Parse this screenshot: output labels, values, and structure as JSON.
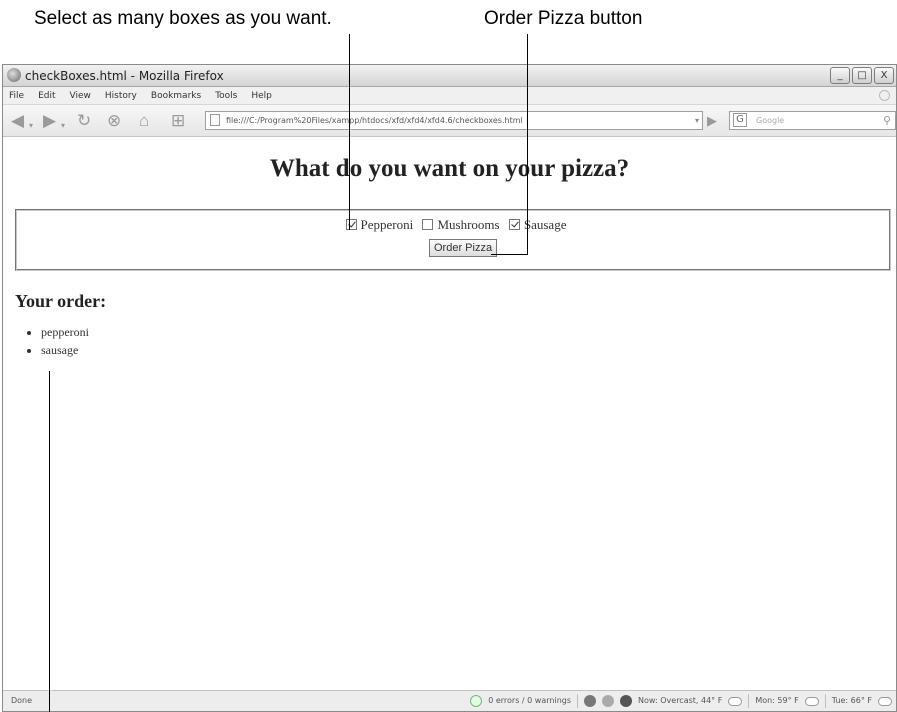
{
  "annotations": {
    "checkboxes_callout": "Select as many boxes as you want.",
    "button_callout": "Order Pizza button"
  },
  "window": {
    "title": "checkBoxes.html - Mozilla Firefox",
    "controls": {
      "minimize": "_",
      "maximize": "□",
      "close": "X"
    }
  },
  "menu": [
    "File",
    "Edit",
    "View",
    "History",
    "Bookmarks",
    "Tools",
    "Help"
  ],
  "navigation": {
    "address": "file:///C:/Program%20Files/xampp/htdocs/xfd/xfd4/xfd4.6/checkboxes.html",
    "search_placeholder": "Google",
    "search_engine_glyph": "G"
  },
  "page": {
    "heading": "What do you want on your pizza?",
    "toppings": [
      {
        "label": "Pepperoni",
        "checked": true
      },
      {
        "label": "Mushrooms",
        "checked": false
      },
      {
        "label": "Sausage",
        "checked": true
      }
    ],
    "submit_label": "Order Pizza",
    "order_heading": "Your order:",
    "order_items": [
      "pepperoni",
      "sausage"
    ]
  },
  "status": {
    "left": "Done",
    "errors": "0 errors / 0 warnings",
    "weather_now": "Now: Overcast, 44° F",
    "weather_mon": "Mon: 59° F",
    "weather_tue": "Tue: 66° F"
  },
  "colors": {
    "window_border": "#8a8a8a",
    "statusbar": "#ededed"
  }
}
